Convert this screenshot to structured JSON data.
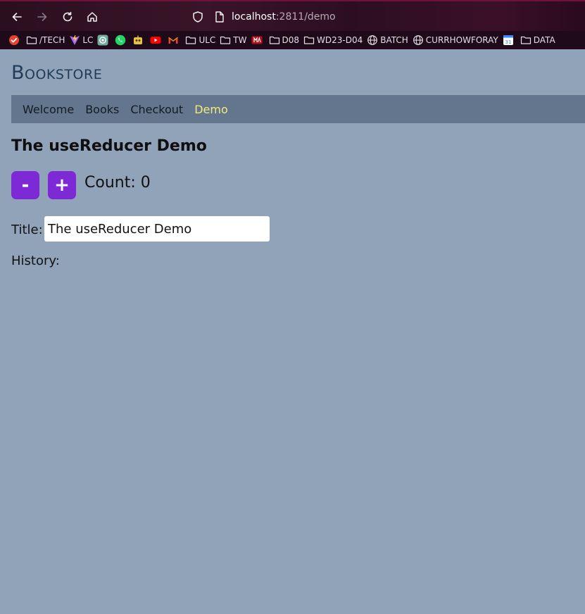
{
  "browser": {
    "url_host": "localhost",
    "url_rest": ":2811/demo",
    "bookmarks": [
      {
        "label": "",
        "icon": "todo-check-icon"
      },
      {
        "label": "/TECH",
        "icon": "folder-icon"
      },
      {
        "label": "LC",
        "icon": "vite-icon"
      },
      {
        "label": "",
        "icon": "chatgpt-icon"
      },
      {
        "label": "",
        "icon": "whatsapp-icon"
      },
      {
        "label": "",
        "icon": "bot-icon"
      },
      {
        "label": "",
        "icon": "youtube-icon"
      },
      {
        "label": "",
        "icon": "gmail-icon"
      },
      {
        "label": "ULC",
        "icon": "folder-icon"
      },
      {
        "label": "TW",
        "icon": "folder-icon"
      },
      {
        "label": "",
        "icon": "marvel-icon"
      },
      {
        "label": "D08",
        "icon": "folder-icon"
      },
      {
        "label": "WD23-D04",
        "icon": "folder-icon"
      },
      {
        "label": "BATCH",
        "icon": "globe-icon"
      },
      {
        "label": "CURRHOWFORAY",
        "icon": "globe-icon"
      },
      {
        "label": "",
        "icon": "calendar-icon"
      },
      {
        "label": "DATA",
        "icon": "folder-icon"
      }
    ]
  },
  "app": {
    "brand": "Bookstore",
    "nav": [
      {
        "label": "Welcome",
        "active": false
      },
      {
        "label": "Books",
        "active": false
      },
      {
        "label": "Checkout",
        "active": false
      },
      {
        "label": "Demo",
        "active": true
      }
    ]
  },
  "demo": {
    "heading": "The useReducer Demo",
    "decrement_label": "-",
    "increment_label": "+",
    "count_text": "Count: 0",
    "title_label": "Title:",
    "title_value": "The useReducer Demo",
    "history_label": "History:"
  },
  "colors": {
    "page_bg": "#91a3b9",
    "nav_bg": "#64768d",
    "nav_active": "#f4ea7a",
    "button_bg": "#7d2ad6",
    "brand": "#1f3b57"
  }
}
